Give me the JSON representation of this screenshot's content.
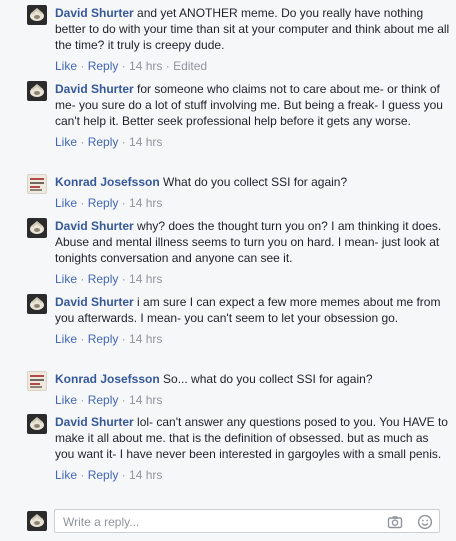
{
  "comments": [
    {
      "author": "David Shurter",
      "text": " and yet ANOTHER meme. Do you really have nothing better to do with your time than sit at your computer and think about me all the time? it truly is creepy dude.",
      "like": "Like",
      "reply": "Reply",
      "time": "14 hrs",
      "edited": "Edited",
      "avatar": "david"
    },
    {
      "author": "David Shurter",
      "text": " for someone who claims not to care about me- or think of me- you sure do a lot of stuff involving me. But being a freak- I guess you can't help it. Better seek professional help before it gets any worse.",
      "like": "Like",
      "reply": "Reply",
      "time": "14 hrs",
      "avatar": "david"
    },
    {
      "author": "Konrad Josefsson",
      "text": " What do you collect SSI for again?",
      "like": "Like",
      "reply": "Reply",
      "time": "14 hrs",
      "avatar": "konrad"
    },
    {
      "author": "David Shurter",
      "text": " why? does the thought turn you on? I am thinking it does. Abuse and mental illness seems to turn you on hard. I mean- just look at tonights conversation and anyone can see it.",
      "like": "Like",
      "reply": "Reply",
      "time": "14 hrs",
      "avatar": "david"
    },
    {
      "author": "David Shurter",
      "text": " i am sure I can expect a few more memes about me from you afterwards. I mean- you can't seem to let your obsession go.",
      "like": "Like",
      "reply": "Reply",
      "time": "14 hrs",
      "avatar": "david"
    },
    {
      "author": "Konrad Josefsson",
      "text": " So... what do you collect SSI for again?",
      "like": "Like",
      "reply": "Reply",
      "time": "14 hrs",
      "avatar": "konrad"
    },
    {
      "author": "David Shurter",
      "text": " lol- can't answer any questions posed to you. You HAVE to make it all about me. that is the definition of obsessed. but as much as you want it- I have never been interested in gargoyles with a small penis.",
      "like": "Like",
      "reply": "Reply",
      "time": "14 hrs",
      "avatar": "david"
    }
  ],
  "reply_box": {
    "placeholder": "Write a reply...",
    "camera_icon": "camera-icon",
    "emoji_icon": "emoji-icon"
  },
  "colors": {
    "author": "#365899",
    "link": "#4267b2",
    "meta": "#90949c",
    "background": "#f6f7f9"
  }
}
